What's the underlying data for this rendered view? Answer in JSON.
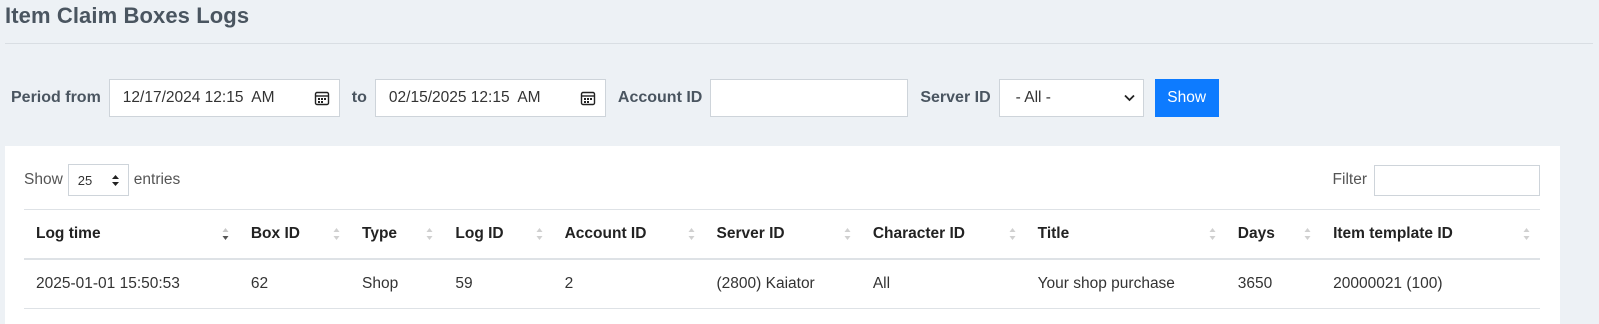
{
  "page": {
    "title": "Item Claim Boxes Logs"
  },
  "filters": {
    "period_from_label": "Period from",
    "period_from_value": "12/17/2024 12:15  AM",
    "to_label": "to",
    "period_to_value": "02/15/2025 12:15  AM",
    "account_id_label": "Account ID",
    "account_id_value": "",
    "server_id_label": "Server ID",
    "server_id_selected": "- All -",
    "show_button": "Show"
  },
  "table_controls": {
    "show_label": "Show",
    "page_length": "25",
    "entries_label": "entries",
    "filter_label": "Filter",
    "filter_value": ""
  },
  "table": {
    "columns": [
      "Log time",
      "Box ID",
      "Type",
      "Log ID",
      "Account ID",
      "Server ID",
      "Character ID",
      "Title",
      "Days",
      "Item template ID"
    ],
    "sorted_column": "Log time",
    "sort_direction": "desc",
    "rows": [
      [
        "2025-01-01 15:50:53",
        "62",
        "Shop",
        "59",
        "2",
        "(2800) Kaiator",
        "All",
        "Your shop purchase",
        "3650",
        "20000021 (100)"
      ]
    ]
  },
  "colors": {
    "page_background": "#edf1f5",
    "accent": "#0d7bff",
    "title_text": "#4a5560"
  },
  "icons": [
    "calendar-icon",
    "chevron-down-icon",
    "sort-icon",
    "sort-desc-icon"
  ]
}
